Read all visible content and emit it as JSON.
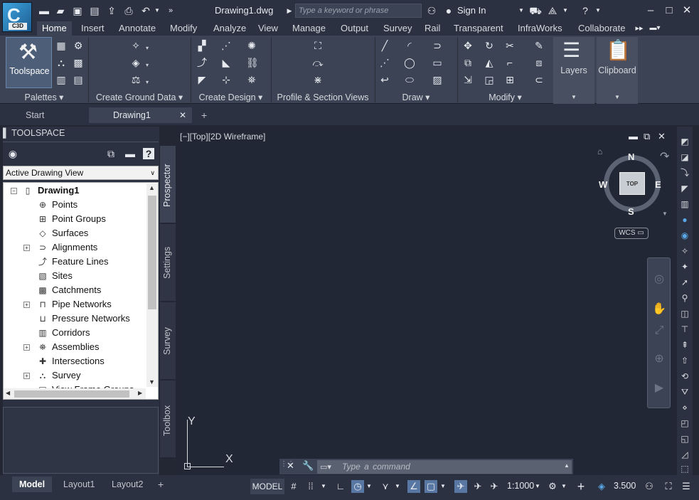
{
  "titlebar": {
    "logo": "C3D",
    "document_title": "Drawing1.dwg",
    "search_placeholder": "Type a keyword or phrase",
    "sign_in": "Sign In"
  },
  "ribbon_tabs": [
    "Home",
    "Insert",
    "Annotate",
    "Modify",
    "Analyze",
    "View",
    "Manage",
    "Output",
    "Survey",
    "Rail",
    "Transparent",
    "InfraWorks",
    "Collaborate"
  ],
  "active_tab": "Home",
  "ribbon_panels": {
    "palettes": "Palettes",
    "toolspace": "Toolspace",
    "create_ground_data": "Create Ground Data",
    "create_design": "Create Design",
    "profile_section_views": "Profile & Section Views",
    "draw": "Draw",
    "modify": "Modify",
    "layers": "Layers",
    "clipboard": "Clipboard"
  },
  "file_tabs": [
    "Start",
    "Drawing1"
  ],
  "toolspace": {
    "header": "TOOLSPACE",
    "view_select": "Active Drawing View",
    "root": "Drawing1",
    "items": [
      "Points",
      "Point Groups",
      "Surfaces",
      "Alignments",
      "Feature Lines",
      "Sites",
      "Catchments",
      "Pipe Networks",
      "Pressure Networks",
      "Corridors",
      "Assemblies",
      "Intersections",
      "Survey",
      "View Frame Groups"
    ],
    "side_tabs": [
      "Prospector",
      "Settings",
      "Survey",
      "Toolbox"
    ]
  },
  "viewport": {
    "label": "[−][Top][2D Wireframe]",
    "compass": {
      "n": "N",
      "s": "S",
      "e": "E",
      "w": "W",
      "cube": "TOP"
    },
    "wcs": "WCS",
    "ucs_x": "X",
    "ucs_y": "Y"
  },
  "command": {
    "placeholder": "Type a command"
  },
  "layout_tabs": [
    "Model",
    "Layout1",
    "Layout2"
  ],
  "status": {
    "model": "MODEL",
    "scale": "1:1000",
    "elevation": "3.500"
  }
}
